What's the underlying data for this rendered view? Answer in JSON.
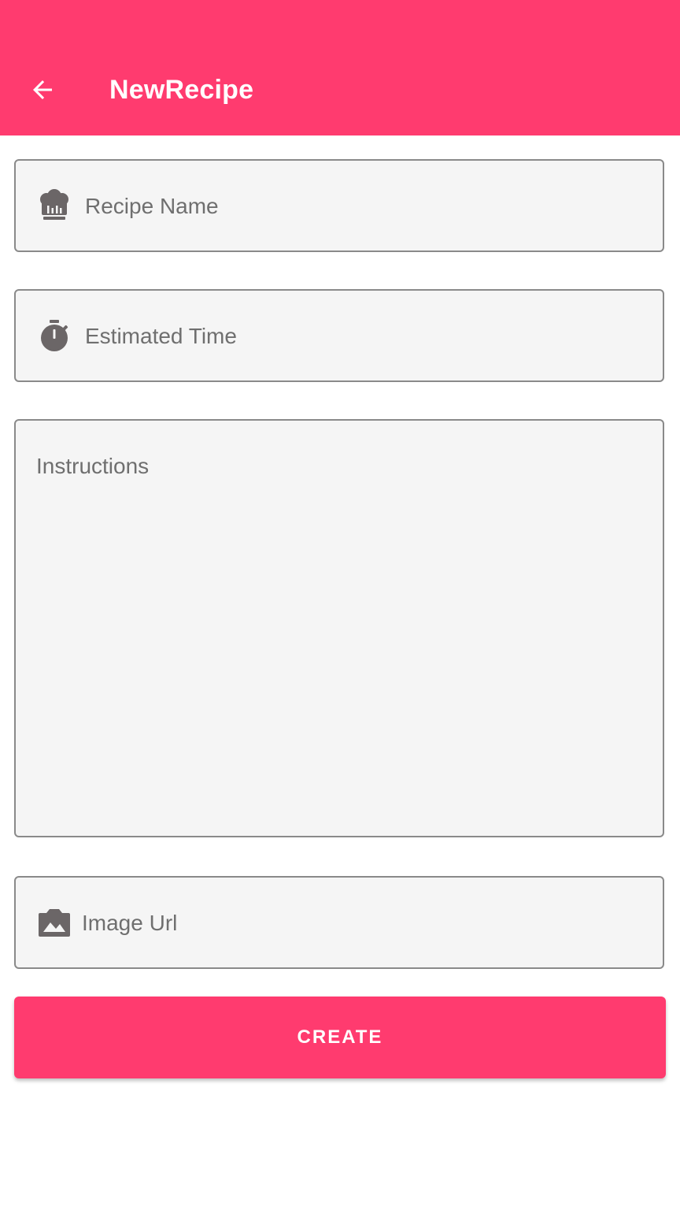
{
  "colors": {
    "accent": "#ff3b6f",
    "field_background": "#f5f5f5",
    "field_border": "#8a8a8a",
    "icon": "#6b6667",
    "placeholder": "#6f6f6f"
  },
  "appbar": {
    "title": "NewRecipe",
    "back_icon": "arrow-back-icon"
  },
  "form": {
    "recipe_name": {
      "placeholder": "Recipe Name",
      "value": "",
      "icon": "chef-hat-icon"
    },
    "estimated_time": {
      "placeholder": "Estimated Time",
      "value": "",
      "icon": "stopwatch-icon"
    },
    "instructions": {
      "placeholder": "Instructions",
      "value": ""
    },
    "image_url": {
      "placeholder": "Image Url",
      "value": "",
      "icon": "camera-image-icon"
    }
  },
  "actions": {
    "create_label": "CREATE"
  }
}
